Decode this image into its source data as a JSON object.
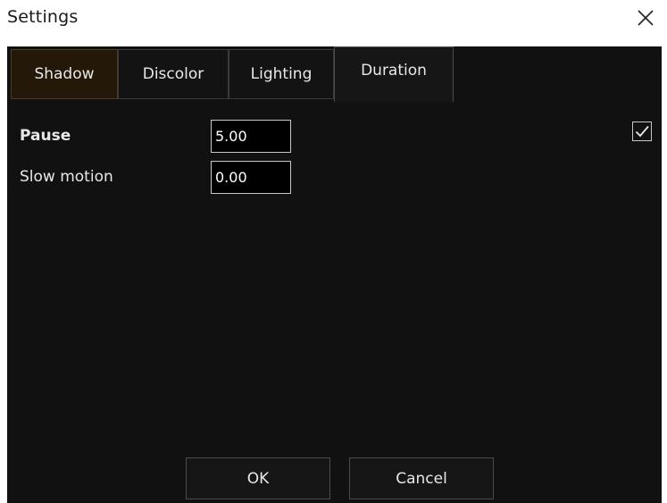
{
  "window": {
    "title": "Settings",
    "close_icon": "close-icon"
  },
  "tabs": [
    {
      "label": "Shadow",
      "state": "highlighted"
    },
    {
      "label": "Discolor",
      "state": "normal"
    },
    {
      "label": "Lighting",
      "state": "normal"
    },
    {
      "label": "Duration",
      "state": "selected"
    }
  ],
  "duration": {
    "pause": {
      "label": "Pause",
      "value": "5.00"
    },
    "slow_motion": {
      "label": "Slow motion",
      "value": "0.00"
    },
    "enabled": true
  },
  "buttons": {
    "ok": "OK",
    "cancel": "Cancel"
  },
  "colors": {
    "panel_bg": "#111111",
    "shadow_tab_bg": "#241808",
    "field_bg": "#000000",
    "text": "#e8e8e8"
  }
}
